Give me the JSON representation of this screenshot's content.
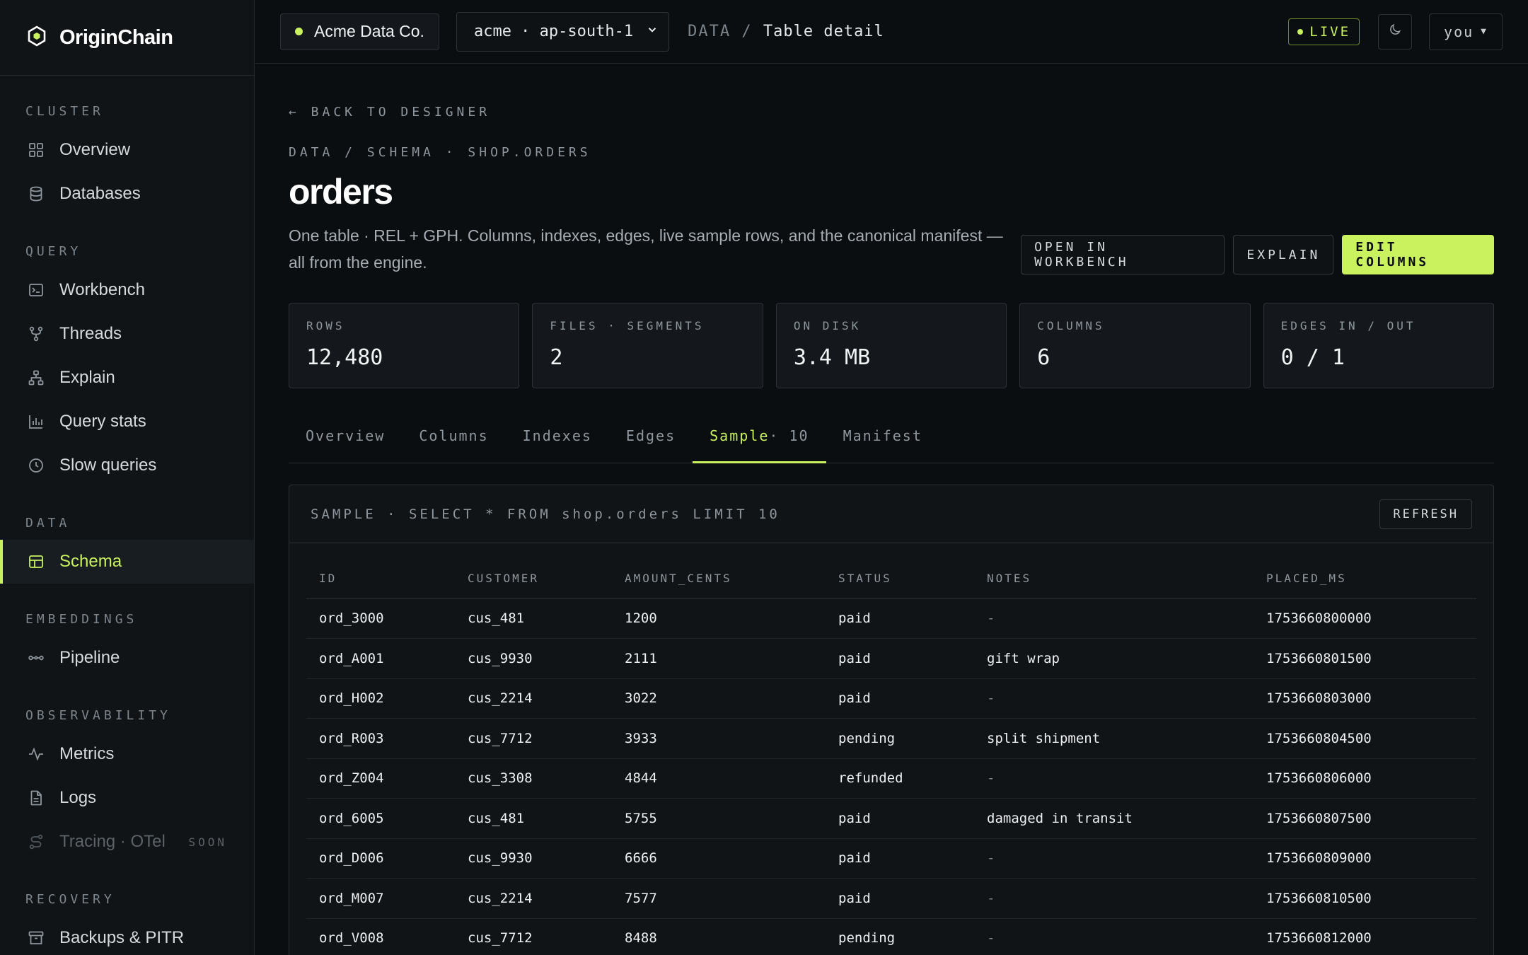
{
  "brand": {
    "name": "OriginChain"
  },
  "sidebar": {
    "sections": [
      {
        "heading": "CLUSTER",
        "items": [
          {
            "label": "Overview"
          },
          {
            "label": "Databases"
          }
        ]
      },
      {
        "heading": "QUERY",
        "items": [
          {
            "label": "Workbench"
          },
          {
            "label": "Threads"
          },
          {
            "label": "Explain"
          },
          {
            "label": "Query stats"
          },
          {
            "label": "Slow queries"
          }
        ]
      },
      {
        "heading": "DATA",
        "items": [
          {
            "label": "Schema"
          }
        ]
      },
      {
        "heading": "EMBEDDINGS",
        "items": [
          {
            "label": "Pipeline"
          }
        ]
      },
      {
        "heading": "OBSERVABILITY",
        "items": [
          {
            "label": "Metrics"
          },
          {
            "label": "Logs"
          },
          {
            "label": "Tracing · OTel",
            "badge": "SOON"
          }
        ]
      },
      {
        "heading": "RECOVERY",
        "items": [
          {
            "label": "Backups & PITR"
          }
        ]
      }
    ],
    "active": "Schema"
  },
  "topbar": {
    "org": "Acme Data Co.",
    "cluster": "acme · ap-south-1",
    "crumb_root": "DATA /",
    "crumb_current": "Table detail",
    "live": "LIVE",
    "user": "you"
  },
  "page": {
    "back": "← BACK TO DESIGNER",
    "path": "DATA / SCHEMA · SHOP.ORDERS",
    "title": "orders",
    "description": "One table · REL + GPH. Columns, indexes, edges, live sample rows, and the canonical manifest — all from the engine.",
    "actions": {
      "workbench": "OPEN IN WORKBENCH",
      "explain": "EXPLAIN",
      "edit": "EDIT COLUMNS"
    }
  },
  "stats": [
    {
      "label": "ROWS",
      "value": "12,480"
    },
    {
      "label": "FILES · SEGMENTS",
      "value": "2"
    },
    {
      "label": "ON DISK",
      "value": "3.4 MB"
    },
    {
      "label": "COLUMNS",
      "value": "6"
    },
    {
      "label": "EDGES IN / OUT",
      "value": "0 / 1"
    }
  ],
  "tabs": [
    {
      "label": "Overview"
    },
    {
      "label": "Columns"
    },
    {
      "label": "Indexes"
    },
    {
      "label": "Edges"
    },
    {
      "label": "Sample",
      "count": " · 10"
    },
    {
      "label": "Manifest"
    }
  ],
  "sample": {
    "title": "SAMPLE · SELECT * FROM shop.orders LIMIT 10",
    "refresh": "REFRESH",
    "columns": [
      "ID",
      "CUSTOMER",
      "AMOUNT_CENTS",
      "STATUS",
      "NOTES",
      "PLACED_MS"
    ],
    "rows": [
      [
        "ord_3000",
        "cus_481",
        "1200",
        "paid",
        "-",
        "1753660800000"
      ],
      [
        "ord_A001",
        "cus_9930",
        "2111",
        "paid",
        "gift wrap",
        "1753660801500"
      ],
      [
        "ord_H002",
        "cus_2214",
        "3022",
        "paid",
        "-",
        "1753660803000"
      ],
      [
        "ord_R003",
        "cus_7712",
        "3933",
        "pending",
        "split shipment",
        "1753660804500"
      ],
      [
        "ord_Z004",
        "cus_3308",
        "4844",
        "refunded",
        "-",
        "1753660806000"
      ],
      [
        "ord_6005",
        "cus_481",
        "5755",
        "paid",
        "damaged in transit",
        "1753660807500"
      ],
      [
        "ord_D006",
        "cus_9930",
        "6666",
        "paid",
        "-",
        "1753660809000"
      ],
      [
        "ord_M007",
        "cus_2214",
        "7577",
        "paid",
        "-",
        "1753660810500"
      ],
      [
        "ord_V008",
        "cus_7712",
        "8488",
        "pending",
        "-",
        "1753660812000"
      ]
    ]
  },
  "colors": {
    "accent": "#c9f25e",
    "background": "#0b0e11",
    "sidebar": "#111417"
  }
}
